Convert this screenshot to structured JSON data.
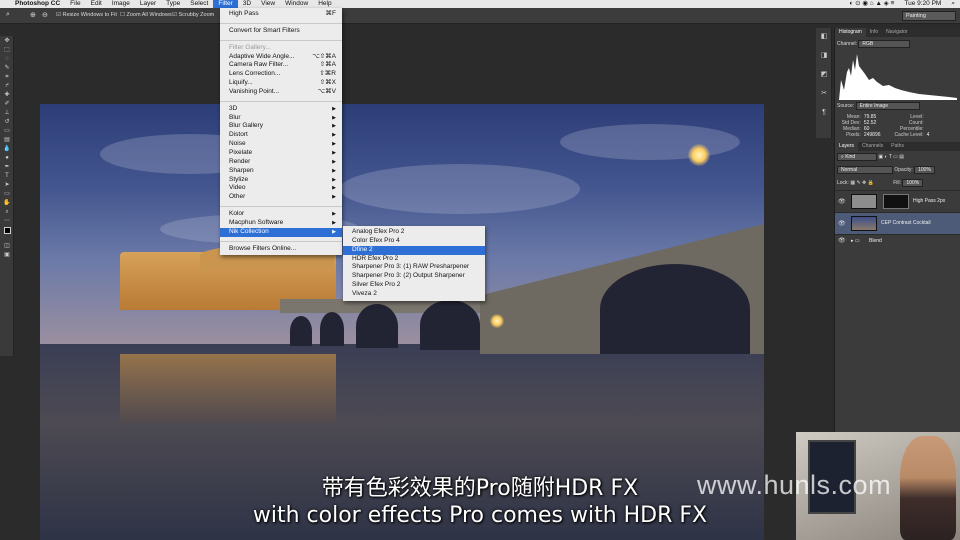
{
  "menubar": {
    "apple": "",
    "app_name": "Photoshop CC",
    "items": [
      "File",
      "Edit",
      "Image",
      "Layer",
      "Type",
      "Select",
      "Filter",
      "3D",
      "View",
      "Window",
      "Help"
    ],
    "active": "Filter",
    "clock": "Tue 9:20 PM"
  },
  "options": {
    "resize_windows": "Resize Windows to Fit",
    "zoom_all": "Zoom All Windows",
    "scrubby_zoom": "Scrubby Zoom",
    "workspace": "Painting"
  },
  "filter_menu": {
    "items": [
      {
        "label": "High Pass",
        "shortcut": "⌘F"
      },
      {
        "sep": true
      },
      {
        "label": "Convert for Smart Filters"
      },
      {
        "sep": true
      },
      {
        "label": "Filter Gallery...",
        "disabled": true
      },
      {
        "label": "Adaptive Wide Angle...",
        "shortcut": "⌥⇧⌘A"
      },
      {
        "label": "Camera Raw Filter...",
        "shortcut": "⇧⌘A"
      },
      {
        "label": "Lens Correction...",
        "shortcut": "⇧⌘R"
      },
      {
        "label": "Liquify...",
        "shortcut": "⇧⌘X"
      },
      {
        "label": "Vanishing Point...",
        "shortcut": "⌥⌘V"
      },
      {
        "sep": true
      },
      {
        "label": "3D",
        "sub": true
      },
      {
        "label": "Blur",
        "sub": true
      },
      {
        "label": "Blur Gallery",
        "sub": true
      },
      {
        "label": "Distort",
        "sub": true
      },
      {
        "label": "Noise",
        "sub": true
      },
      {
        "label": "Pixelate",
        "sub": true
      },
      {
        "label": "Render",
        "sub": true
      },
      {
        "label": "Sharpen",
        "sub": true
      },
      {
        "label": "Stylize",
        "sub": true
      },
      {
        "label": "Video",
        "sub": true
      },
      {
        "label": "Other",
        "sub": true
      },
      {
        "sep": true
      },
      {
        "label": "Kolor",
        "sub": true
      },
      {
        "label": "Macphun Software",
        "sub": true
      },
      {
        "label": "Nik Collection",
        "sub": true,
        "highlighted": true
      },
      {
        "sep": true
      },
      {
        "label": "Browse Filters Online..."
      }
    ]
  },
  "nik_submenu": {
    "items": [
      {
        "label": "Analog Efex Pro 2"
      },
      {
        "label": "Color Efex Pro 4"
      },
      {
        "label": "Dfine 2",
        "highlighted": true
      },
      {
        "label": "HDR Efex Pro 2"
      },
      {
        "label": "Sharpener Pro 3: (1) RAW Presharpener"
      },
      {
        "label": "Sharpener Pro 3: (2) Output Sharpener"
      },
      {
        "label": "Silver Efex Pro 2"
      },
      {
        "label": "Viveza 2"
      }
    ]
  },
  "histogram_panel": {
    "tabs": [
      "Histogram",
      "Info",
      "Navigator"
    ],
    "channel_label": "Channel:",
    "channel_value": "RGB",
    "source_label": "Source:",
    "source_value": "Entire Image",
    "stats": [
      {
        "k": "Mean:",
        "v": "79.85",
        "k2": "Level:",
        "v2": ""
      },
      {
        "k": "Std Dev:",
        "v": "52.52",
        "k2": "Count:",
        "v2": ""
      },
      {
        "k": "Median:",
        "v": "60",
        "k2": "Percentile:",
        "v2": ""
      },
      {
        "k": "Pixels:",
        "v": "249896",
        "k2": "Cache Level:",
        "v2": "4"
      }
    ]
  },
  "layers_panel": {
    "tabs": [
      "Layers",
      "Channels",
      "Paths"
    ],
    "kind": "Kind",
    "blend_mode": "Normal",
    "opacity_label": "Opacity:",
    "opacity": "100%",
    "lock_label": "Lock:",
    "fill_label": "Fill:",
    "fill": "100%",
    "layers": [
      {
        "name": "High Pass 2px"
      },
      {
        "name": "CEP Contrast Cocktail"
      },
      {
        "name": "Blend"
      }
    ]
  },
  "subtitles": {
    "chinese": "带有色彩效果的Pro随附HDR FX",
    "english": "with color effects Pro comes with HDR FX"
  },
  "watermark": "www.hunls.com"
}
